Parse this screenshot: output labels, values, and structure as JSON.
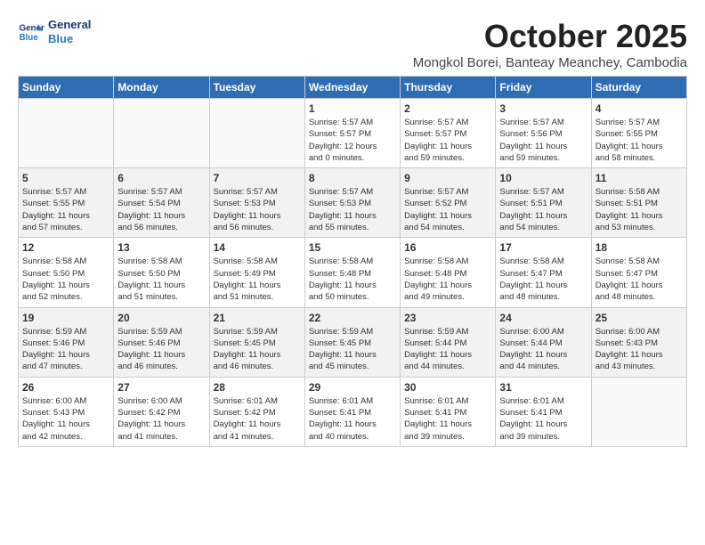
{
  "header": {
    "logo_line1": "General",
    "logo_line2": "Blue",
    "month_title": "October 2025",
    "subtitle": "Mongkol Borei, Banteay Meanchey, Cambodia"
  },
  "weekdays": [
    "Sunday",
    "Monday",
    "Tuesday",
    "Wednesday",
    "Thursday",
    "Friday",
    "Saturday"
  ],
  "weeks": [
    {
      "shaded": false,
      "days": [
        {
          "number": "",
          "info": ""
        },
        {
          "number": "",
          "info": ""
        },
        {
          "number": "",
          "info": ""
        },
        {
          "number": "1",
          "info": "Sunrise: 5:57 AM\nSunset: 5:57 PM\nDaylight: 12 hours\nand 0 minutes."
        },
        {
          "number": "2",
          "info": "Sunrise: 5:57 AM\nSunset: 5:57 PM\nDaylight: 11 hours\nand 59 minutes."
        },
        {
          "number": "3",
          "info": "Sunrise: 5:57 AM\nSunset: 5:56 PM\nDaylight: 11 hours\nand 59 minutes."
        },
        {
          "number": "4",
          "info": "Sunrise: 5:57 AM\nSunset: 5:55 PM\nDaylight: 11 hours\nand 58 minutes."
        }
      ]
    },
    {
      "shaded": true,
      "days": [
        {
          "number": "5",
          "info": "Sunrise: 5:57 AM\nSunset: 5:55 PM\nDaylight: 11 hours\nand 57 minutes."
        },
        {
          "number": "6",
          "info": "Sunrise: 5:57 AM\nSunset: 5:54 PM\nDaylight: 11 hours\nand 56 minutes."
        },
        {
          "number": "7",
          "info": "Sunrise: 5:57 AM\nSunset: 5:53 PM\nDaylight: 11 hours\nand 56 minutes."
        },
        {
          "number": "8",
          "info": "Sunrise: 5:57 AM\nSunset: 5:53 PM\nDaylight: 11 hours\nand 55 minutes."
        },
        {
          "number": "9",
          "info": "Sunrise: 5:57 AM\nSunset: 5:52 PM\nDaylight: 11 hours\nand 54 minutes."
        },
        {
          "number": "10",
          "info": "Sunrise: 5:57 AM\nSunset: 5:51 PM\nDaylight: 11 hours\nand 54 minutes."
        },
        {
          "number": "11",
          "info": "Sunrise: 5:58 AM\nSunset: 5:51 PM\nDaylight: 11 hours\nand 53 minutes."
        }
      ]
    },
    {
      "shaded": false,
      "days": [
        {
          "number": "12",
          "info": "Sunrise: 5:58 AM\nSunset: 5:50 PM\nDaylight: 11 hours\nand 52 minutes."
        },
        {
          "number": "13",
          "info": "Sunrise: 5:58 AM\nSunset: 5:50 PM\nDaylight: 11 hours\nand 51 minutes."
        },
        {
          "number": "14",
          "info": "Sunrise: 5:58 AM\nSunset: 5:49 PM\nDaylight: 11 hours\nand 51 minutes."
        },
        {
          "number": "15",
          "info": "Sunrise: 5:58 AM\nSunset: 5:48 PM\nDaylight: 11 hours\nand 50 minutes."
        },
        {
          "number": "16",
          "info": "Sunrise: 5:58 AM\nSunset: 5:48 PM\nDaylight: 11 hours\nand 49 minutes."
        },
        {
          "number": "17",
          "info": "Sunrise: 5:58 AM\nSunset: 5:47 PM\nDaylight: 11 hours\nand 48 minutes."
        },
        {
          "number": "18",
          "info": "Sunrise: 5:58 AM\nSunset: 5:47 PM\nDaylight: 11 hours\nand 48 minutes."
        }
      ]
    },
    {
      "shaded": true,
      "days": [
        {
          "number": "19",
          "info": "Sunrise: 5:59 AM\nSunset: 5:46 PM\nDaylight: 11 hours\nand 47 minutes."
        },
        {
          "number": "20",
          "info": "Sunrise: 5:59 AM\nSunset: 5:46 PM\nDaylight: 11 hours\nand 46 minutes."
        },
        {
          "number": "21",
          "info": "Sunrise: 5:59 AM\nSunset: 5:45 PM\nDaylight: 11 hours\nand 46 minutes."
        },
        {
          "number": "22",
          "info": "Sunrise: 5:59 AM\nSunset: 5:45 PM\nDaylight: 11 hours\nand 45 minutes."
        },
        {
          "number": "23",
          "info": "Sunrise: 5:59 AM\nSunset: 5:44 PM\nDaylight: 11 hours\nand 44 minutes."
        },
        {
          "number": "24",
          "info": "Sunrise: 6:00 AM\nSunset: 5:44 PM\nDaylight: 11 hours\nand 44 minutes."
        },
        {
          "number": "25",
          "info": "Sunrise: 6:00 AM\nSunset: 5:43 PM\nDaylight: 11 hours\nand 43 minutes."
        }
      ]
    },
    {
      "shaded": false,
      "days": [
        {
          "number": "26",
          "info": "Sunrise: 6:00 AM\nSunset: 5:43 PM\nDaylight: 11 hours\nand 42 minutes."
        },
        {
          "number": "27",
          "info": "Sunrise: 6:00 AM\nSunset: 5:42 PM\nDaylight: 11 hours\nand 41 minutes."
        },
        {
          "number": "28",
          "info": "Sunrise: 6:01 AM\nSunset: 5:42 PM\nDaylight: 11 hours\nand 41 minutes."
        },
        {
          "number": "29",
          "info": "Sunrise: 6:01 AM\nSunset: 5:41 PM\nDaylight: 11 hours\nand 40 minutes."
        },
        {
          "number": "30",
          "info": "Sunrise: 6:01 AM\nSunset: 5:41 PM\nDaylight: 11 hours\nand 39 minutes."
        },
        {
          "number": "31",
          "info": "Sunrise: 6:01 AM\nSunset: 5:41 PM\nDaylight: 11 hours\nand 39 minutes."
        },
        {
          "number": "",
          "info": ""
        }
      ]
    }
  ]
}
